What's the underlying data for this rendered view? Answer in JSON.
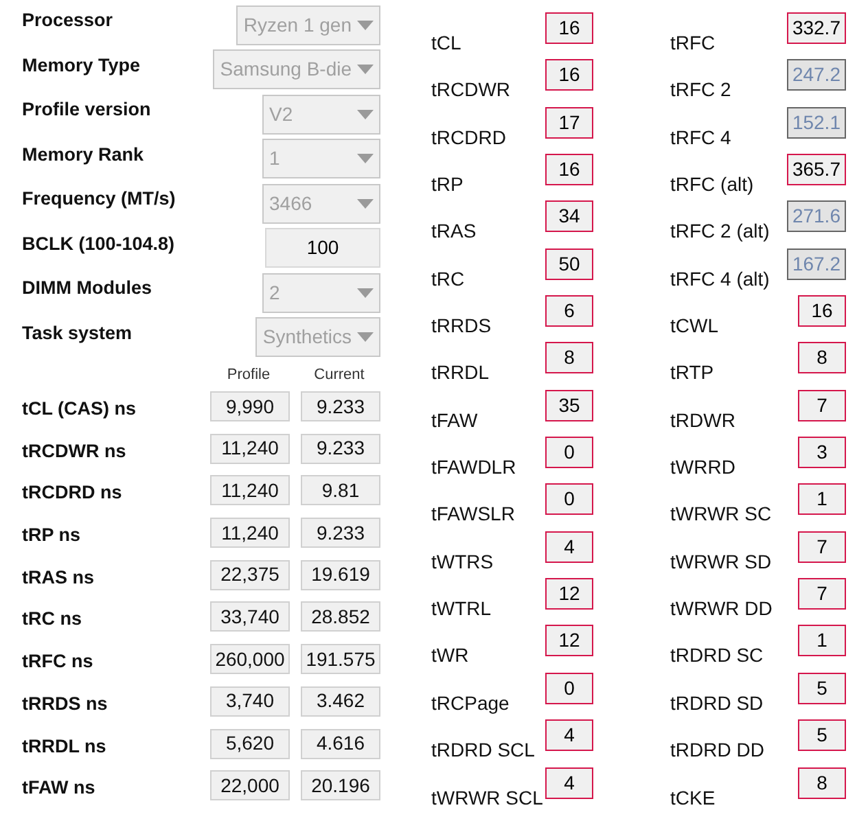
{
  "settings": [
    {
      "label": "Processor",
      "kind": "dropdown",
      "value": "Ryzen 1 gen"
    },
    {
      "label": "Memory Type",
      "kind": "dropdown",
      "value": "Samsung B-die"
    },
    {
      "label": "Profile version",
      "kind": "dropdown",
      "value": "V2"
    },
    {
      "label": "Memory Rank",
      "kind": "dropdown",
      "value": "1"
    },
    {
      "label": "Frequency (MT/s)",
      "kind": "dropdown",
      "value": "3466"
    },
    {
      "label": "BCLK (100-104.8)",
      "kind": "input",
      "value": "100"
    },
    {
      "label": "DIMM Modules",
      "kind": "dropdown",
      "value": "2"
    },
    {
      "label": "Task system",
      "kind": "dropdown",
      "value": "Synthetics"
    }
  ],
  "ns_table": {
    "columns": [
      "Profile",
      "Current"
    ],
    "rows": [
      {
        "label": "tCL (CAS) ns",
        "profile": "9,990",
        "current": "9.233"
      },
      {
        "label": "tRCDWR ns",
        "profile": "11,240",
        "current": "9.233"
      },
      {
        "label": "tRCDRD ns",
        "profile": "11,240",
        "current": "9.81"
      },
      {
        "label": "tRP ns",
        "profile": "11,240",
        "current": "9.233"
      },
      {
        "label": "tRAS ns",
        "profile": "22,375",
        "current": "19.619"
      },
      {
        "label": "tRC ns",
        "profile": "33,740",
        "current": "28.852"
      },
      {
        "label": "tRFC ns",
        "profile": "260,000",
        "current": "191.575"
      },
      {
        "label": "tRRDS ns",
        "profile": "3,740",
        "current": "3.462"
      },
      {
        "label": "tRRDL ns",
        "profile": "5,620",
        "current": "4.616"
      },
      {
        "label": "tFAW ns",
        "profile": "22,000",
        "current": "20.196"
      }
    ]
  },
  "timings_left": [
    {
      "label": "tCL",
      "value": "16",
      "disabled": false
    },
    {
      "label": "tRCDWR",
      "value": "16",
      "disabled": false
    },
    {
      "label": "tRCDRD",
      "value": "17",
      "disabled": false
    },
    {
      "label": "tRP",
      "value": "16",
      "disabled": false
    },
    {
      "label": "tRAS",
      "value": "34",
      "disabled": false
    },
    {
      "label": "tRC",
      "value": "50",
      "disabled": false
    },
    {
      "label": "tRRDS",
      "value": "6",
      "disabled": false
    },
    {
      "label": "tRRDL",
      "value": "8",
      "disabled": false
    },
    {
      "label": "tFAW",
      "value": "35",
      "disabled": false
    },
    {
      "label": "tFAWDLR",
      "value": "0",
      "disabled": false
    },
    {
      "label": "tFAWSLR",
      "value": "0",
      "disabled": false
    },
    {
      "label": "tWTRS",
      "value": "4",
      "disabled": false
    },
    {
      "label": "tWTRL",
      "value": "12",
      "disabled": false
    },
    {
      "label": "tWR",
      "value": "12",
      "disabled": false
    },
    {
      "label": "tRCPage",
      "value": "0",
      "disabled": false
    },
    {
      "label": "tRDRD SCL",
      "value": "4",
      "disabled": false
    },
    {
      "label": "tWRWR SCL",
      "value": "4",
      "disabled": false
    }
  ],
  "timings_right": [
    {
      "label": "tRFC",
      "value": "332.7",
      "disabled": false
    },
    {
      "label": "tRFC 2",
      "value": "247.2",
      "disabled": true
    },
    {
      "label": "tRFC 4",
      "value": "152.1",
      "disabled": true
    },
    {
      "label": "tRFC (alt)",
      "value": "365.7",
      "disabled": false
    },
    {
      "label": "tRFC 2 (alt)",
      "value": "271.6",
      "disabled": true
    },
    {
      "label": "tRFC 4 (alt)",
      "value": "167.2",
      "disabled": true
    },
    {
      "label": "tCWL",
      "value": "16",
      "disabled": false
    },
    {
      "label": "tRTP",
      "value": "8",
      "disabled": false
    },
    {
      "label": "tRDWR",
      "value": "7",
      "disabled": false
    },
    {
      "label": "tWRRD",
      "value": "3",
      "disabled": false
    },
    {
      "label": "tWRWR SC",
      "value": "1",
      "disabled": false
    },
    {
      "label": "tWRWR SD",
      "value": "7",
      "disabled": false
    },
    {
      "label": "tWRWR DD",
      "value": "7",
      "disabled": false
    },
    {
      "label": "tRDRD SC",
      "value": "1",
      "disabled": false
    },
    {
      "label": "tRDRD SD",
      "value": "5",
      "disabled": false
    },
    {
      "label": "tRDRD DD",
      "value": "5",
      "disabled": false
    },
    {
      "label": "tCKE",
      "value": "8",
      "disabled": false
    }
  ]
}
